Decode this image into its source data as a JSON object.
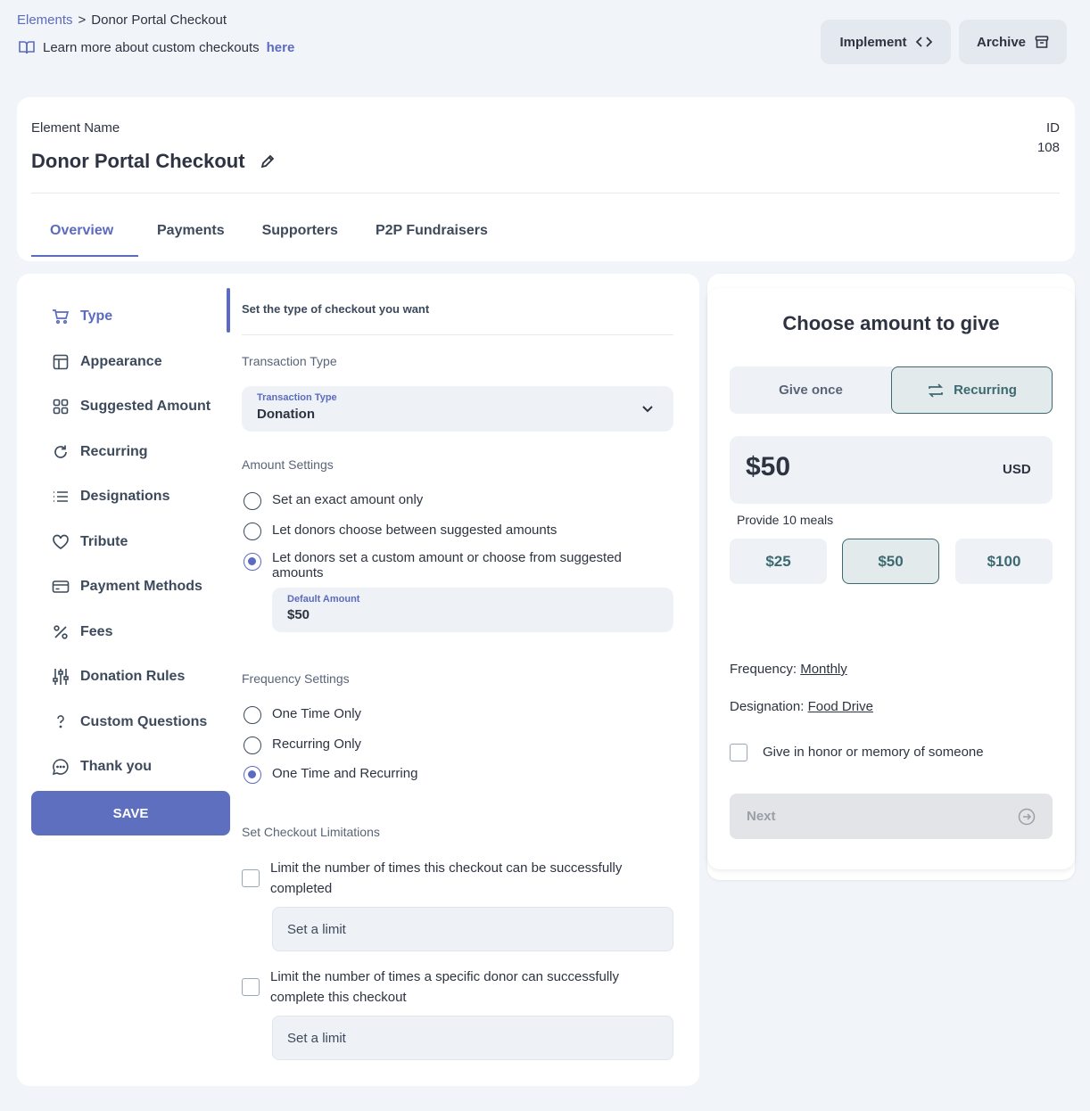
{
  "breadcrumb": {
    "root": "Elements",
    "separator": ">",
    "current": "Donor Portal Checkout"
  },
  "learn_more": {
    "text": "Learn more about custom checkouts",
    "link": "here"
  },
  "actions": {
    "implement": "Implement",
    "archive": "Archive"
  },
  "element": {
    "name_label": "Element Name",
    "name": "Donor Portal Checkout",
    "id_label": "ID",
    "id": "108"
  },
  "tabs": [
    {
      "label": "Overview",
      "active": true
    },
    {
      "label": "Payments"
    },
    {
      "label": "Supporters"
    },
    {
      "label": "P2P Fundraisers"
    }
  ],
  "sidebar": {
    "items": [
      {
        "label": "Type",
        "icon": "cart-icon",
        "active": true
      },
      {
        "label": "Appearance",
        "icon": "layout-icon"
      },
      {
        "label": "Suggested Amount",
        "icon": "grid-icon"
      },
      {
        "label": "Recurring",
        "icon": "refresh-icon"
      },
      {
        "label": "Designations",
        "icon": "list-icon"
      },
      {
        "label": "Tribute",
        "icon": "heart-icon"
      },
      {
        "label": "Payment Methods",
        "icon": "card-icon"
      },
      {
        "label": "Fees",
        "icon": "percent-icon"
      },
      {
        "label": "Donation Rules",
        "icon": "sliders-icon"
      },
      {
        "label": "Custom Questions",
        "icon": "question-icon"
      },
      {
        "label": "Thank you",
        "icon": "chat-icon"
      }
    ],
    "save_label": "SAVE"
  },
  "form": {
    "section_title": "Set the type of checkout you want",
    "transaction_group": "Transaction Type",
    "transaction_select": {
      "label": "Transaction Type",
      "value": "Donation"
    },
    "amount_group": "Amount Settings",
    "amount_options": [
      {
        "label": "Set an exact amount only",
        "checked": false
      },
      {
        "label": "Let donors choose between suggested amounts",
        "checked": false
      },
      {
        "label": "Let donors set a custom amount or choose from suggested amounts",
        "checked": true
      }
    ],
    "default_amount": {
      "label": "Default Amount",
      "value": "$50"
    },
    "frequency_group": "Frequency Settings",
    "frequency_options": [
      {
        "label": "One Time Only",
        "checked": false
      },
      {
        "label": "Recurring Only",
        "checked": false
      },
      {
        "label": "One Time and Recurring",
        "checked": true
      }
    ],
    "limitations_group": "Set Checkout Limitations",
    "limitations": [
      {
        "label": "Limit the number of times this checkout can be successfully completed",
        "checked": false,
        "placeholder": "Set a limit"
      },
      {
        "label": "Limit the number of times a specific donor can successfully complete this checkout",
        "checked": false,
        "placeholder": "Set a limit"
      }
    ]
  },
  "preview": {
    "title": "Choose amount to give",
    "give_once": "Give once",
    "recurring": "Recurring",
    "amount": "$50",
    "currency": "USD",
    "amount_desc": "Provide 10 meals",
    "presets": [
      {
        "label": "$25",
        "selected": false
      },
      {
        "label": "$50",
        "selected": true
      },
      {
        "label": "$100",
        "selected": false
      }
    ],
    "frequency_label": "Frequency:",
    "frequency_value": "Monthly",
    "designation_label": "Designation:",
    "designation_value": "Food Drive",
    "tribute_label": "Give in honor or memory of someone",
    "next_label": "Next"
  },
  "colors": {
    "accent": "#5b6bbf",
    "teal": "#3c6a70",
    "background": "#f1f4f8"
  }
}
